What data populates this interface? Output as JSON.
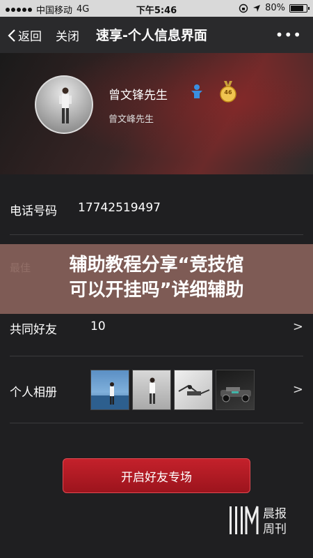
{
  "status_bar": {
    "carrier": "中国移动",
    "network": "4G",
    "time": "下午5:46",
    "battery": "80%",
    "battery_level": 0.8
  },
  "nav": {
    "back_label": "返回",
    "close_label": "关闭",
    "title": "速享-个人信息界面",
    "more_label": "•••"
  },
  "profile": {
    "name": "曾文锋先生",
    "sub_name": "曾文峰先生",
    "level": "46"
  },
  "rows": {
    "phone_label": "电话号码",
    "phone_value": "17742519497",
    "best_label": "最佳",
    "common_friends_label": "共同好友",
    "common_friends_value": "10",
    "album_label": "个人相册",
    "chevron": ">"
  },
  "banner": {
    "line1": "辅助教程分享“竞技馆",
    "line2": "可以开挂吗”详细辅助"
  },
  "cta": {
    "label": "开启好友专场"
  },
  "watermark": {
    "line1": "晨报",
    "line2": "周刊"
  },
  "colors": {
    "accent": "#c4212b",
    "background": "#1f1f21",
    "banner": "#8c645c"
  },
  "icons": {
    "back": "chevron-left-icon",
    "more": "more-icon",
    "gender": "male-icon",
    "level": "medal-icon",
    "location": "location-arrow-icon",
    "lock": "rotation-lock-icon",
    "battery": "battery-icon"
  }
}
